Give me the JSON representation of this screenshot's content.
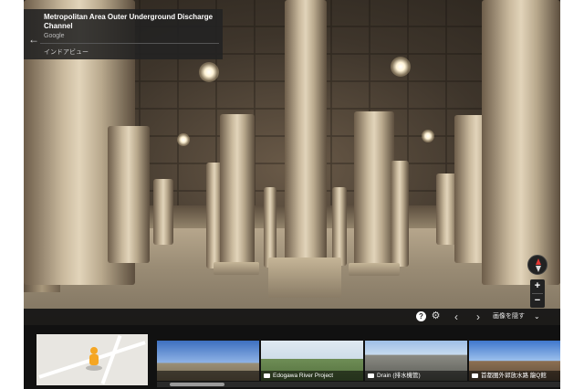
{
  "place": {
    "title": "Metropolitan Area Outer Underground Discharge Channel",
    "source": "Google",
    "indoor_view_label": "インドアビュー"
  },
  "controls": {
    "back_icon": "back-arrow-icon",
    "compass_icon": "compass-icon",
    "zoom_in_label": "+",
    "zoom_out_label": "−"
  },
  "strip_bar": {
    "help_label": "?",
    "prev_label": "‹",
    "next_label": "›",
    "hide_images_label": "画像を隠す",
    "hide_chevron_label": "⌄"
  },
  "filmstrip": {
    "thumbnails": [
      {
        "caption": ""
      },
      {
        "caption": "Edogawa River Project"
      },
      {
        "caption": "Drain (排水機管)"
      },
      {
        "caption": "首都圏外郭放水路 龍Q館"
      }
    ]
  },
  "colors": {
    "compass_north": "#e53935",
    "pegman": "#f5a623",
    "panel_bg": "#222222"
  }
}
